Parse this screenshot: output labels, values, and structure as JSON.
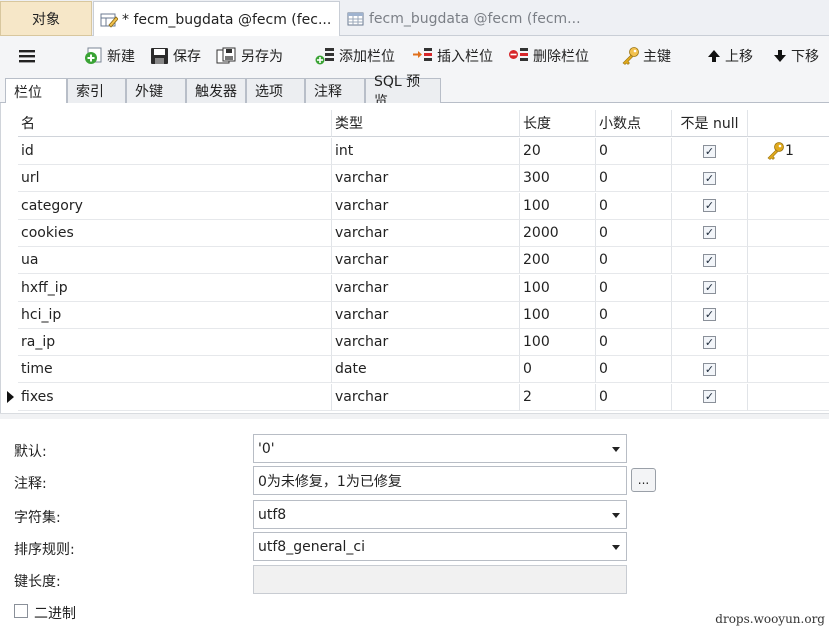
{
  "doc_tabs": [
    {
      "label": "对象"
    },
    {
      "label": "* fecm_bugdata @fecm (fec..."
    },
    {
      "label": "fecm_bugdata @fecm (fecm..."
    }
  ],
  "toolbar": {
    "new": "新建",
    "save": "保存",
    "save_as": "另存为",
    "add_field": "添加栏位",
    "insert_field": "插入栏位",
    "delete_field": "删除栏位",
    "primary_key": "主键",
    "move_up": "上移",
    "move_down": "下移"
  },
  "sub_tabs": [
    "栏位",
    "索引",
    "外键",
    "触发器",
    "选项",
    "注释",
    "SQL 预览"
  ],
  "grid": {
    "headers": [
      "名",
      "类型",
      "长度",
      "小数点",
      "不是 null",
      ""
    ],
    "rows": [
      {
        "name": "id",
        "type": "int",
        "length": "20",
        "decimals": "0",
        "not_null": true,
        "key": "1"
      },
      {
        "name": "url",
        "type": "varchar",
        "length": "300",
        "decimals": "0",
        "not_null": true,
        "key": ""
      },
      {
        "name": "category",
        "type": "varchar",
        "length": "100",
        "decimals": "0",
        "not_null": true,
        "key": ""
      },
      {
        "name": "cookies",
        "type": "varchar",
        "length": "2000",
        "decimals": "0",
        "not_null": true,
        "key": ""
      },
      {
        "name": "ua",
        "type": "varchar",
        "length": "200",
        "decimals": "0",
        "not_null": true,
        "key": ""
      },
      {
        "name": "hxff_ip",
        "type": "varchar",
        "length": "100",
        "decimals": "0",
        "not_null": true,
        "key": ""
      },
      {
        "name": "hci_ip",
        "type": "varchar",
        "length": "100",
        "decimals": "0",
        "not_null": true,
        "key": ""
      },
      {
        "name": "ra_ip",
        "type": "varchar",
        "length": "100",
        "decimals": "0",
        "not_null": true,
        "key": ""
      },
      {
        "name": "time",
        "type": "date",
        "length": "0",
        "decimals": "0",
        "not_null": true,
        "key": ""
      },
      {
        "name": "fixes",
        "type": "varchar",
        "length": "2",
        "decimals": "0",
        "not_null": true,
        "key": ""
      }
    ]
  },
  "properties": {
    "default_label": "默认:",
    "default_value": "'0'",
    "comment_label": "注释:",
    "comment_value": "0为未修复，1为已修复",
    "ellipsis": "...",
    "charset_label": "字符集:",
    "charset_value": "utf8",
    "collation_label": "排序规则:",
    "collation_value": "utf8_general_ci",
    "key_length_label": "键长度:",
    "key_length_value": "",
    "binary_label": "二进制"
  },
  "watermark": "drops.wooyun.org",
  "colors": {
    "key_gold": "#e0a91c",
    "active_tab_bg": "#f6e7c8"
  }
}
